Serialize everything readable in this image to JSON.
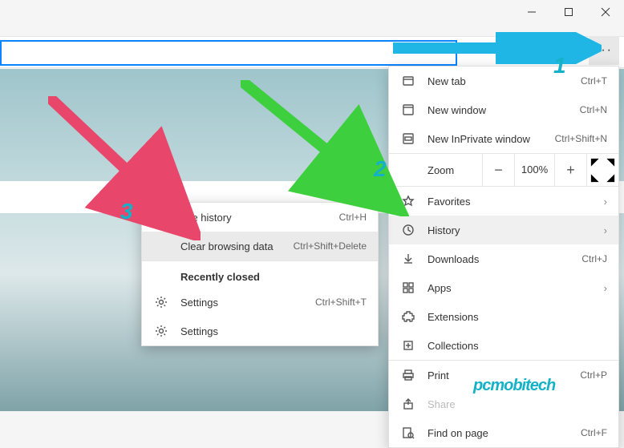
{
  "menu": {
    "newtab": {
      "label": "New tab",
      "shortcut": "Ctrl+T"
    },
    "newwindow": {
      "label": "New window",
      "shortcut": "Ctrl+N"
    },
    "inprivate": {
      "label": "New InPrivate window",
      "shortcut": "Ctrl+Shift+N"
    },
    "zoom": {
      "label": "Zoom",
      "value": "100%"
    },
    "favorites": {
      "label": "Favorites"
    },
    "history": {
      "label": "History"
    },
    "downloads": {
      "label": "Downloads",
      "shortcut": "Ctrl+J"
    },
    "apps": {
      "label": "Apps"
    },
    "extensions": {
      "label": "Extensions"
    },
    "collections": {
      "label": "Collections"
    },
    "print": {
      "label": "Print",
      "shortcut": "Ctrl+P"
    },
    "share": {
      "label": "Share"
    },
    "find": {
      "label": "Find on page",
      "shortcut": "Ctrl+F"
    }
  },
  "submenu": {
    "manage": {
      "label": "age history",
      "shortcut": "Ctrl+H"
    },
    "clear": {
      "label": "Clear browsing data",
      "shortcut": "Ctrl+Shift+Delete"
    },
    "recent_header": "Recently closed",
    "item1": {
      "label": "Settings",
      "shortcut": "Ctrl+Shift+T"
    },
    "item2": {
      "label": "Settings"
    }
  },
  "annotations": {
    "n1": "1",
    "n2": "2",
    "n3": "3",
    "watermark": "pcmobitech"
  }
}
